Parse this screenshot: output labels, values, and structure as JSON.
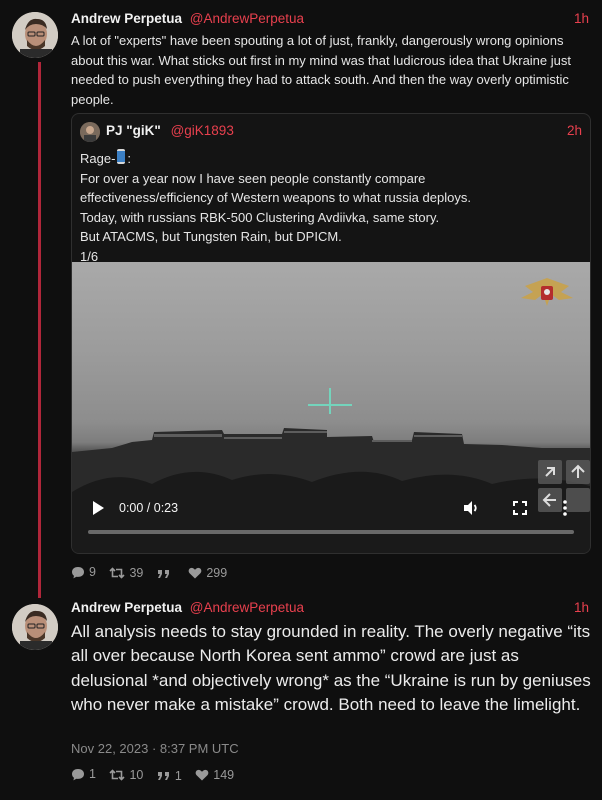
{
  "tweet1": {
    "name": "Andrew Perpetua",
    "handle": "@AndrewPerpetua",
    "time": "1h",
    "text": "A lot of \"experts\" have been spouting a lot of just, frankly, dangerously wrong opinions about this war. What sticks out first in my mind was that ludicrous idea that Ukraine just needed to push everything they had to attack south. And then the way overly optimistic people.",
    "stats": {
      "replies": "9",
      "retweets": "39",
      "quotes": "",
      "likes": "299"
    }
  },
  "quote": {
    "name": "PJ \"giK\"",
    "handle": "@giK1893",
    "time": "2h",
    "lines": [
      "Rage-",
      "For over a year now I have seen people constantly compare",
      "effectiveness/efficiency of Western weapons to what russia deploys.",
      "Today, with russians RBK-500 Clustering Avdiivka, same story.",
      "But ATACMS, but Tungsten Rain, but DPICM.",
      "1/6"
    ],
    "rage_suffix": ":",
    "video": {
      "time": "0:00 / 0:23",
      "progress": 0.0
    }
  },
  "tweet2": {
    "name": "Andrew Perpetua",
    "handle": "@AndrewPerpetua",
    "time": "1h",
    "text": "All analysis needs to stay grounded in reality. The overly negative “its all over because North Korea sent ammo” crowd are just as delusional *and objectively wrong* as the “Ukraine is run by geniuses who never make a mistake” crowd. Both need to leave the limelight.",
    "date": "Nov 22, 2023 · 8:37 PM UTC",
    "stats": {
      "replies": "1",
      "retweets": "10",
      "quotes": "1",
      "likes": "149"
    }
  },
  "colors": {
    "accent": "#e8404e",
    "thread_line": "#b0263a",
    "background": "#0f0f0f",
    "crosshair": "#6fe0c4"
  },
  "icons": [
    "comment-icon",
    "retweet-icon",
    "quote-icon",
    "heart-icon",
    "play-icon",
    "volume-icon",
    "fullscreen-icon",
    "more-icon",
    "thread-emoji-icon",
    "emblem-icon"
  ]
}
